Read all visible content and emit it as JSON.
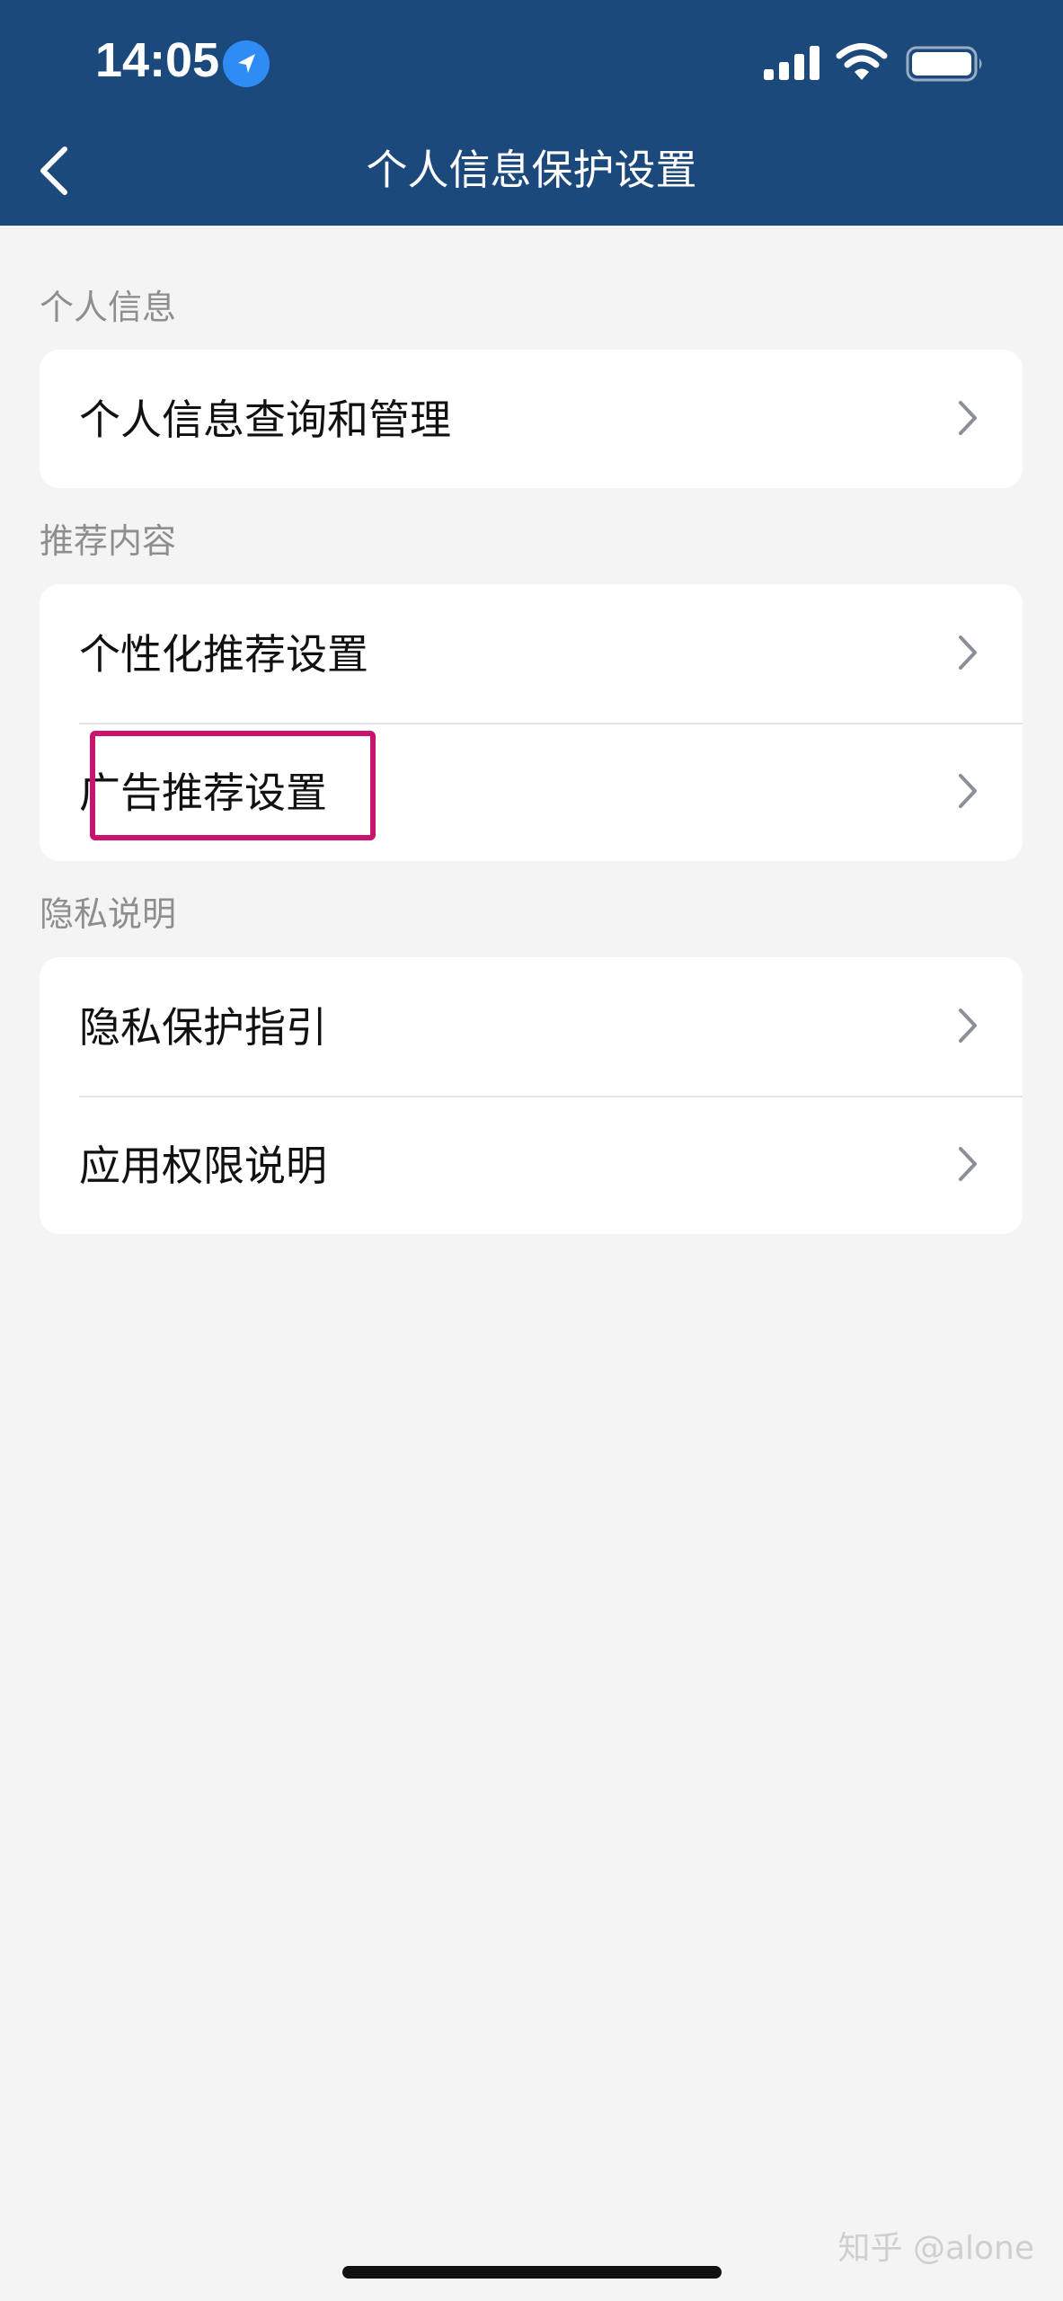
{
  "status_bar": {
    "time": "14:05",
    "icons": [
      "location-arrow-icon",
      "signal-icon",
      "wifi-icon",
      "battery-icon"
    ]
  },
  "nav": {
    "back_icon": "chevron-left-icon",
    "title": "个人信息保护设置"
  },
  "sections": [
    {
      "label": "个人信息",
      "items": [
        {
          "label": "个人信息查询和管理"
        }
      ]
    },
    {
      "label": "推荐内容",
      "items": [
        {
          "label": "个性化推荐设置"
        },
        {
          "label": "广告推荐设置"
        }
      ]
    },
    {
      "label": "隐私说明",
      "items": [
        {
          "label": "隐私保护指引"
        },
        {
          "label": "应用权限说明"
        }
      ]
    }
  ],
  "watermark": "知乎 @alone",
  "colors": {
    "header_bg": "#1c497c",
    "page_bg": "#f4f4f4",
    "highlight": "#c8146e",
    "location_badge": "#2f8cf4"
  }
}
